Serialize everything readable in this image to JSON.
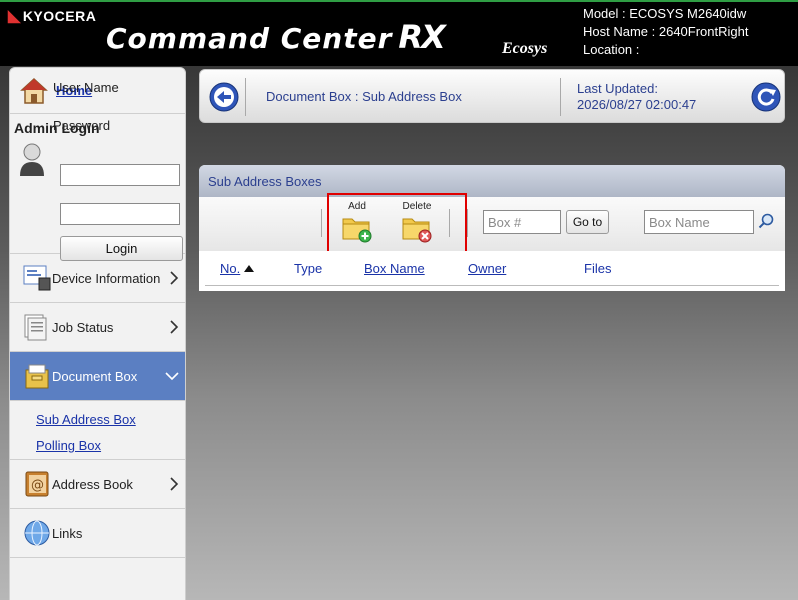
{
  "header": {
    "brand": "KYOCERA",
    "app_title": "Command Center",
    "app_title_suffix": "RX",
    "sub_brand": "Ecosys",
    "model": "Model : ECOSYS M2640idw",
    "host": "Host Name : 2640FrontRight",
    "location": "Location :"
  },
  "sidebar": {
    "home": "Home",
    "admin_title": "Admin Login",
    "username_label": "User Name",
    "password_label": "Password",
    "username_value": "",
    "password_value": "",
    "login_label": "Login",
    "items": [
      {
        "label": "Device Information"
      },
      {
        "label": "Job Status"
      },
      {
        "label": "Document Box"
      },
      {
        "label": "Address Book"
      },
      {
        "label": "Links"
      }
    ],
    "sub_items": [
      {
        "label": "Sub Address Box"
      },
      {
        "label": "Polling Box"
      }
    ]
  },
  "crumb": {
    "path": "Document Box : Sub Address Box",
    "updated_label": "Last Updated:",
    "updated_value": "2026/08/27 02:00:47"
  },
  "panel": {
    "title": "Sub Address Boxes",
    "add_label": "Add",
    "delete_label": "Delete",
    "box_num_placeholder": "Box #",
    "goto_label": "Go to",
    "box_name_placeholder": "Box Name",
    "columns": {
      "no": "No.",
      "type": "Type",
      "box_name": "Box Name",
      "owner": "Owner",
      "files": "Files"
    }
  },
  "colors": {
    "accent": "#5b7fc2",
    "link": "#1a33a8",
    "highlight": "#e00000"
  }
}
